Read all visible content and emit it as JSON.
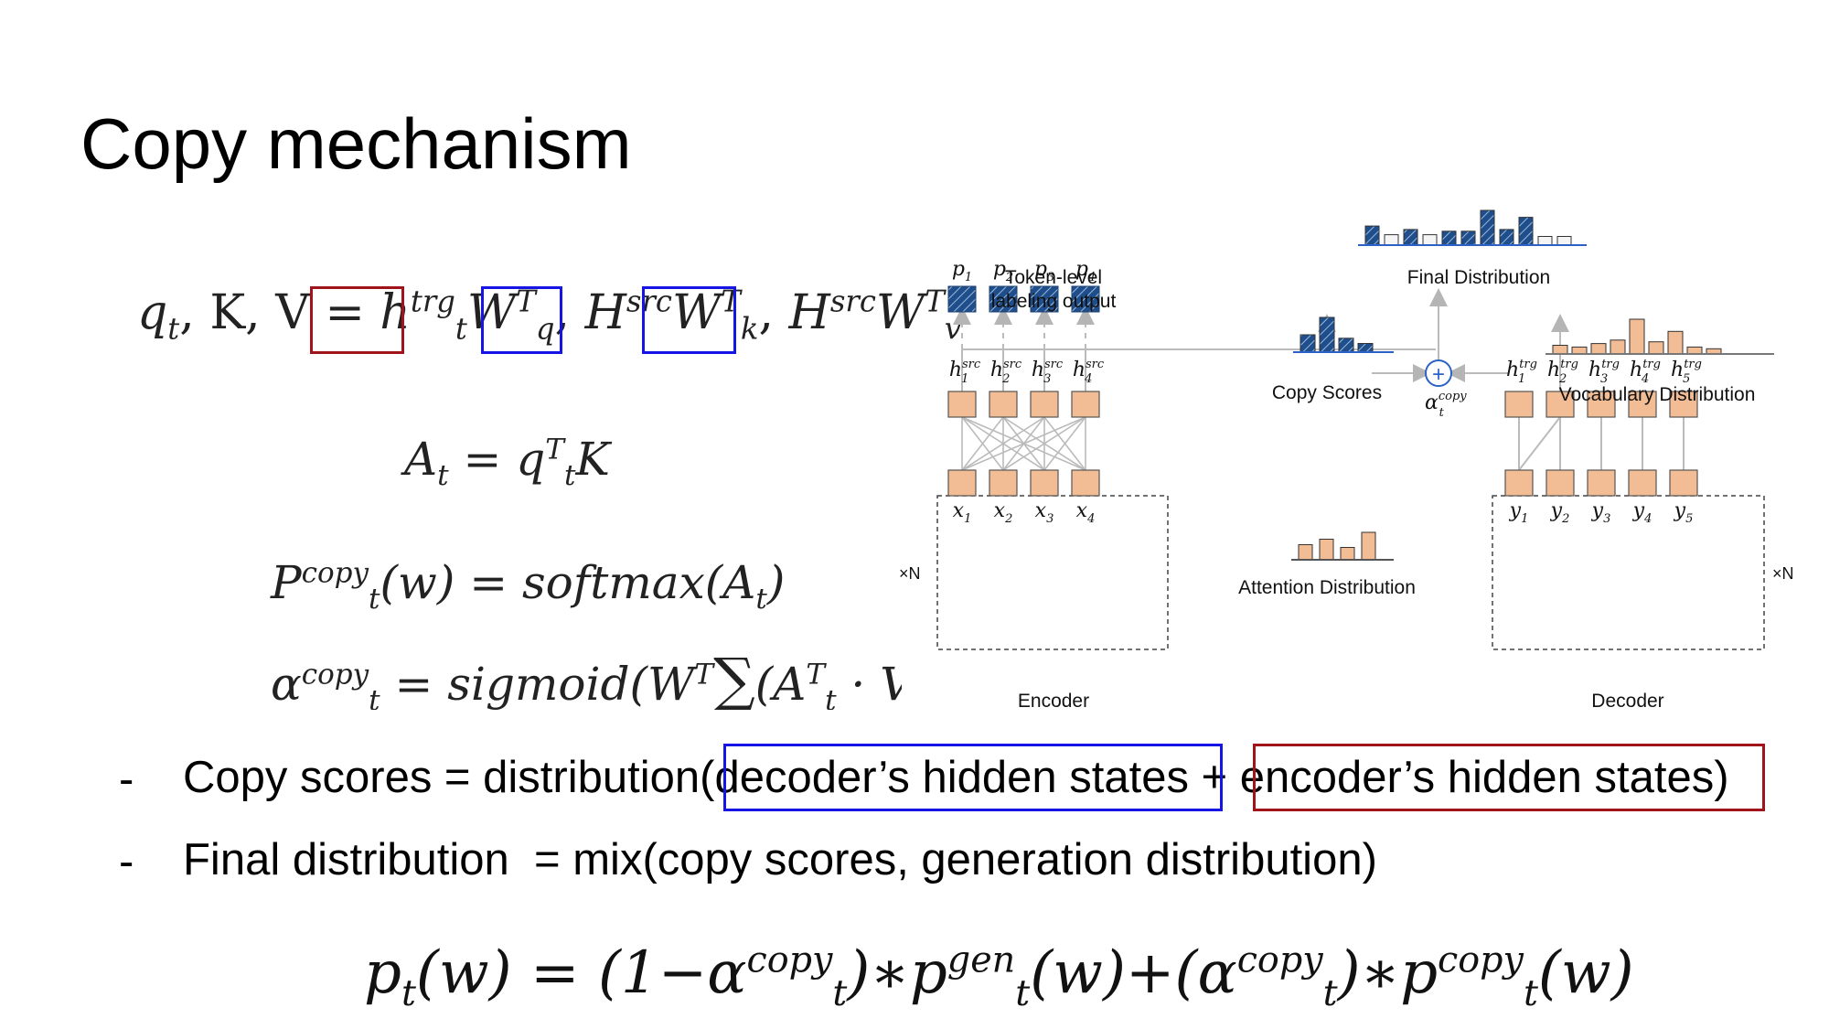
{
  "slide": {
    "title": "Copy mechanism"
  },
  "equations": {
    "qkv": {
      "lhs": "q",
      "lhs_sub": "t",
      "lhs_rest": ", K, V = ",
      "h": "h",
      "h_sup": "trg",
      "h_sub": "t",
      "wq": "W",
      "wq_sup": "T",
      "wq_sub": "q",
      "comma": ", ",
      "H": "H",
      "src": "src",
      "wk": "W",
      "wk_sup": "T",
      "wk_sub": "k",
      "wv": "W",
      "wv_sup": "T",
      "wv_sub": "v"
    },
    "attention": {
      "A": "A",
      "A_sub": "t",
      "eq": " = ",
      "q": "q",
      "q_sup": "T",
      "q_sub": "t",
      "K": "K"
    },
    "p_copy": {
      "P": "P",
      "sup": "copy",
      "sub": "t",
      "rest": "(w) = softmax(A",
      "A_sub": "t",
      "close": ")"
    },
    "alpha_copy": {
      "alpha": "α",
      "sup": "copy",
      "sub": "t",
      "rest": " = sigmoid(W",
      "W_sup": "T",
      "sum": "∑",
      "open": "(A",
      "A_sup": "T",
      "A_sub": "t",
      "tail": " · V))"
    },
    "final": {
      "p": "p",
      "p_sub": "t",
      "a": "(w) = (1−α",
      "a_sup": "copy",
      "a_sub": "t",
      "b": ")∗p",
      "b_sup": "gen",
      "b_sub": "t",
      "c": "(w)+(α",
      "c_sup": "copy",
      "c_sub": "t",
      "d": ")∗p",
      "d_sup": "copy",
      "d_sub": "t",
      "e": "(w)"
    }
  },
  "bullets": [
    {
      "dash": "-",
      "text": "Copy scores = distribution(decoder’s hidden states + encoder’s hidden states)"
    },
    {
      "dash": "-",
      "text": "Final distribution  = mix(copy scores, generation distribution)"
    }
  ],
  "highlight_colors": {
    "red": "#a0141b",
    "blue": "#1515e6"
  },
  "diagram": {
    "labels": {
      "token_level": "Token-level",
      "labeling_output": "labeling output",
      "final_distribution": "Final Distribution",
      "copy_scores": "Copy Scores",
      "vocabulary_distribution": "Vocabulary Distribution",
      "attention_distribution": "Attention Distribution",
      "encoder": "Encoder",
      "decoder": "Decoder",
      "xN_left": "×N",
      "xN_right": "×N",
      "alpha": "α",
      "alpha_sup": "copy",
      "alpha_sub": "t",
      "plus": "+"
    },
    "outputs": [
      "p1",
      "p2",
      "p3",
      "p4"
    ],
    "encoder_inputs": [
      "x1",
      "x2",
      "x3",
      "x4"
    ],
    "encoder_hidden": [
      "h1",
      "h2",
      "h3",
      "h4"
    ],
    "decoder_inputs": [
      "y1",
      "y2",
      "y3",
      "y4",
      "y5"
    ],
    "decoder_hidden": [
      "h1",
      "h2",
      "h3",
      "h4",
      "h5"
    ],
    "src_sup": "src",
    "trg_sup": "trg",
    "final_distribution_bars": [
      0.55,
      0.3,
      0.45,
      0.3,
      0.4,
      0.4,
      1.0,
      0.45,
      0.8,
      0.25,
      0.25
    ],
    "final_distribution_hatched": [
      true,
      false,
      true,
      false,
      true,
      true,
      true,
      true,
      true,
      false,
      false
    ],
    "copy_scores_bars": [
      0.5,
      1.0,
      0.4,
      0.25
    ],
    "vocabulary_bars": [
      0.25,
      0.2,
      0.3,
      0.4,
      1.0,
      0.35,
      0.65,
      0.2,
      0.15
    ],
    "attention_bars": [
      0.55,
      0.75,
      0.45,
      1.0
    ],
    "colors": {
      "node": "#f2bd95",
      "node_stroke": "#555555",
      "hatch": "#1e4f8c",
      "line": "#bbbbbb",
      "axis": "#2c62c8"
    }
  }
}
